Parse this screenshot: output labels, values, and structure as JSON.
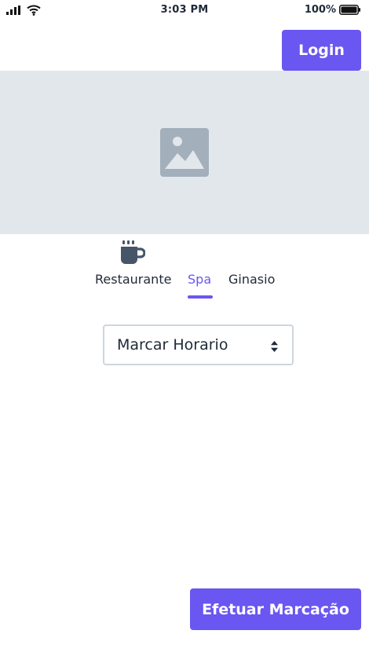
{
  "status_bar": {
    "time": "3:03 PM",
    "battery_percent": "100%",
    "icons": [
      "signal-icon",
      "wifi-icon",
      "battery-icon"
    ]
  },
  "header": {
    "login_label": "Login"
  },
  "hero": {
    "icon": "image-placeholder-icon"
  },
  "category": {
    "icon": "coffee-cup-icon"
  },
  "tabs": [
    {
      "label": "Restaurante",
      "active": false
    },
    {
      "label": "Spa",
      "active": true
    },
    {
      "label": "Ginasio",
      "active": false
    }
  ],
  "schedule_select": {
    "selected": "Marcar Horario",
    "icon": "sort-icon"
  },
  "actions": {
    "submit_label": "Efetuar Marcação"
  },
  "colors": {
    "accent": "#6a56f0",
    "placeholder_bg": "#e2e7ec",
    "placeholder_icon": "#a3afbb",
    "text": "#1f2937"
  }
}
